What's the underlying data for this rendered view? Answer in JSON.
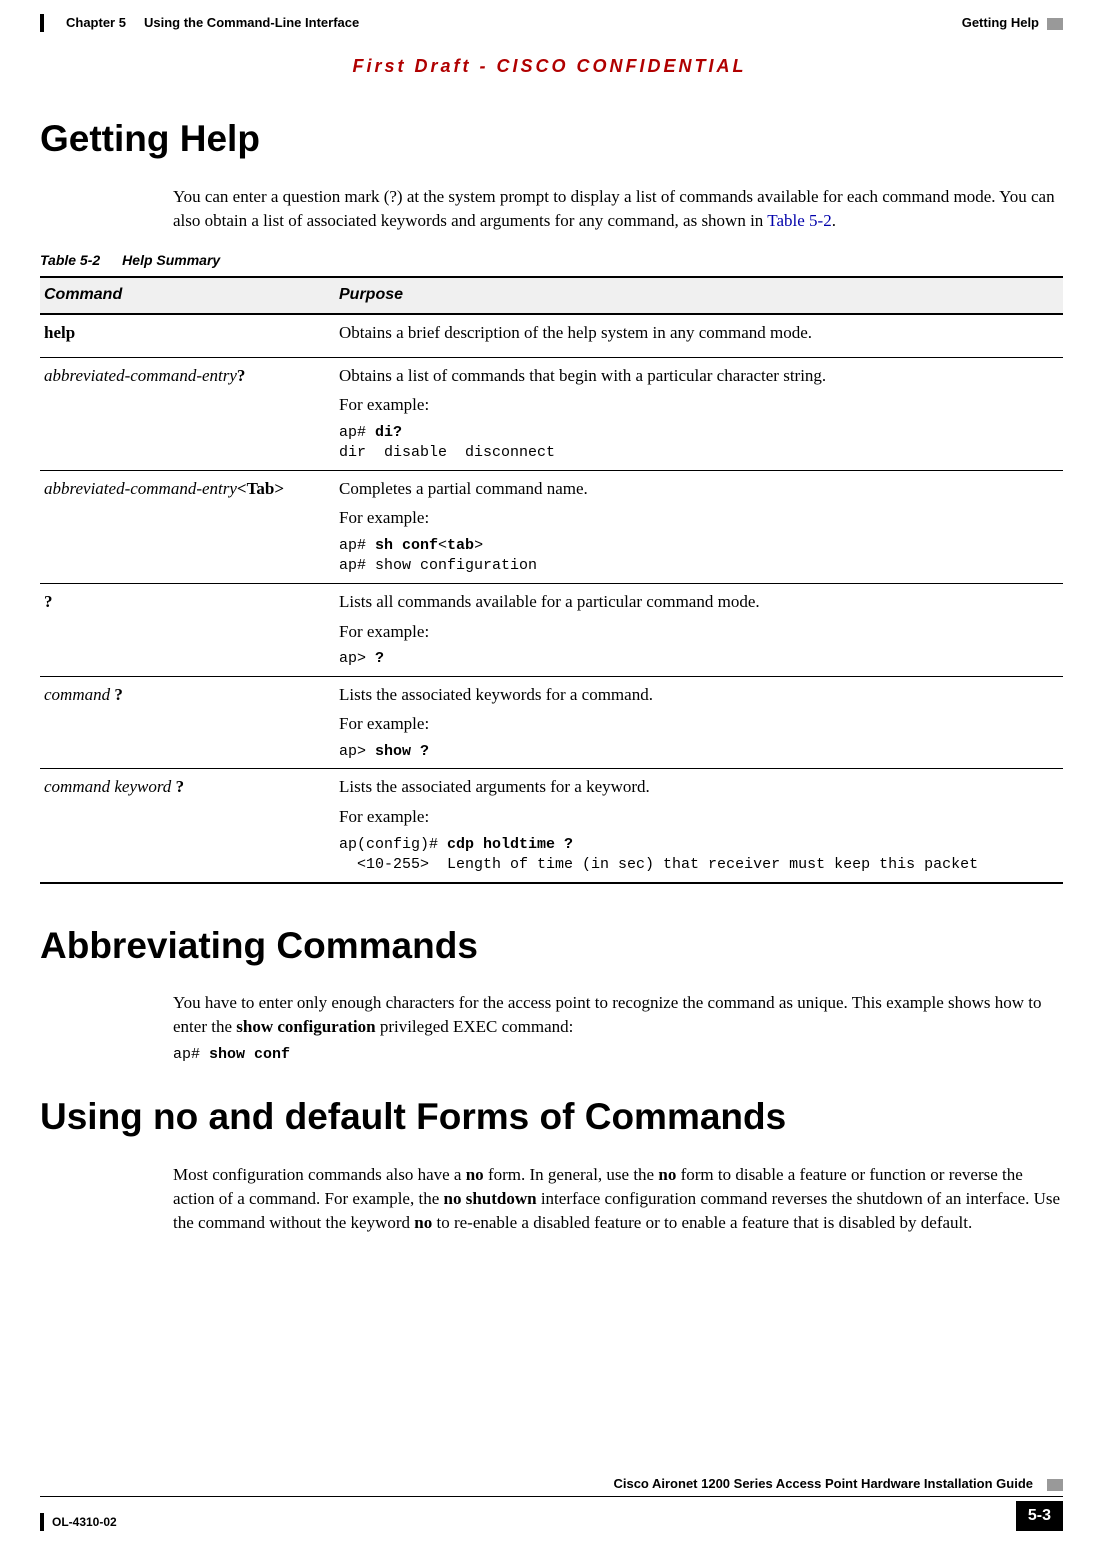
{
  "header": {
    "chapter_label": "Chapter 5",
    "chapter_title": "Using the Command-Line Interface",
    "section_label": "Getting Help"
  },
  "classification": "First Draft - CISCO CONFIDENTIAL",
  "sections": {
    "getting_help": {
      "title": "Getting Help",
      "intro_1": "You can enter a question mark (?) at the system prompt to display a list of commands available for each command mode. You can also obtain a list of associated keywords and arguments for any command, as shown in ",
      "intro_link": "Table 5-2",
      "intro_2": ".",
      "table_caption_num": "Table 5-2",
      "table_caption_title": "Help Summary",
      "table": {
        "headers": {
          "command": "Command",
          "purpose": "Purpose"
        },
        "rows": [
          {
            "cmd_plain_bold": "help",
            "purpose": "Obtains a brief description of the help system in any command mode."
          },
          {
            "cmd_italic": "abbreviated-command-entry",
            "cmd_trailing_bold": "?",
            "purpose": "Obtains a list of commands that begin with a particular character string.",
            "example_label": "For example:",
            "code_prefix": "ap# ",
            "code_bold": "di?",
            "code_suffix": "",
            "code_line2": "dir  disable  disconnect"
          },
          {
            "cmd_italic": "abbreviated-command-entry",
            "cmd_trailing_bold": "<Tab>",
            "purpose": "Completes a partial command name.",
            "example_label": "For example:",
            "code_prefix": "ap# ",
            "code_bold": "sh conf",
            "code_suffix_plain": "<",
            "code_suffix_bold": "tab",
            "code_suffix_plain2": ">",
            "code_line2": "ap# show configuration"
          },
          {
            "cmd_plain_bold": "?",
            "purpose": "Lists all commands available for a particular command mode.",
            "example_label": "For example:",
            "code_prefix": "ap> ",
            "code_bold": "?"
          },
          {
            "cmd_italic": "command",
            "cmd_space_bold": " ?",
            "purpose": "Lists the associated keywords for a command.",
            "example_label": "For example:",
            "code_prefix": "ap> ",
            "code_bold": "show ?"
          },
          {
            "cmd_italic": "command keyword",
            "cmd_space_bold": " ?",
            "purpose": "Lists the associated arguments for a keyword.",
            "example_label": "For example:",
            "code_prefix": "ap(config)# ",
            "code_bold": "cdp holdtime ?",
            "code_line2": "  <10-255>  Length of time (in sec) that receiver must keep this packet"
          }
        ]
      }
    },
    "abbr": {
      "title": "Abbreviating Commands",
      "para_1": "You have to enter only enough characters for the access point to recognize the command as unique. This example shows how to enter the ",
      "para_bold": "show configuration",
      "para_2": " privileged EXEC command:",
      "code_prefix": "ap# ",
      "code_bold": "show conf"
    },
    "nodefault": {
      "title": "Using no and default Forms of Commands",
      "para_1": "Most configuration commands also have a ",
      "b1": "no",
      "para_2": " form. In general, use the ",
      "b2": "no",
      "para_3": " form to disable a feature or function or reverse the action of a command. For example, the ",
      "b3": "no shutdown",
      "para_4": " interface configuration command reverses the shutdown of an interface. Use the command without the keyword ",
      "b4": "no",
      "para_5": " to re-enable a disabled feature or to enable a feature that is disabled by default."
    }
  },
  "footer": {
    "doc_title": "Cisco Aironet 1200 Series Access Point Hardware Installation Guide",
    "doc_id": "OL-4310-02",
    "page_number": "5-3"
  }
}
